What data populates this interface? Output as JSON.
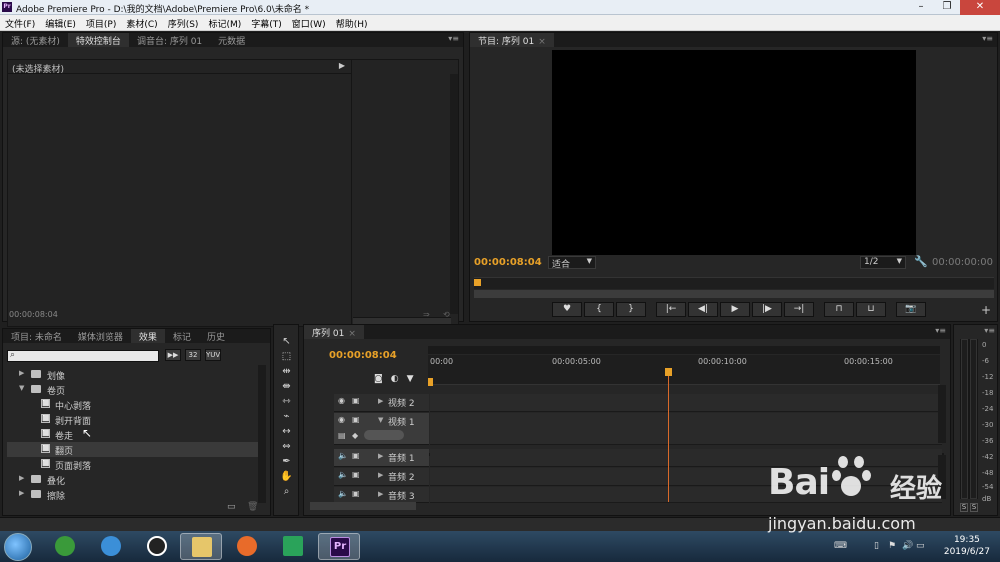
{
  "window": {
    "title": "Adobe Premiere Pro - D:\\我的文档\\Adobe\\Premiere Pro\\6.0\\未命名 *",
    "app_icon_text": "Pr"
  },
  "menu": [
    "文件(F)",
    "编辑(E)",
    "项目(P)",
    "素材(C)",
    "序列(S)",
    "标记(M)",
    "字幕(T)",
    "窗口(W)",
    "帮助(H)"
  ],
  "source_panel": {
    "tabs": [
      {
        "label": "源: (无素材)"
      },
      {
        "label": "特效控制台",
        "active": true
      },
      {
        "label": "调音台: 序列 01"
      },
      {
        "label": "元数据"
      }
    ],
    "header": "(未选择素材)",
    "timecode": "00:00:08:04"
  },
  "program_monitor": {
    "tab": "节目: 序列 01",
    "timecode": "00:00:08:04",
    "fit": "适合",
    "resolution": "1/2",
    "duration": "00:00:00:00",
    "controls": [
      "♥",
      "{",
      "}",
      "|←",
      "◀|",
      "▶",
      "|▶",
      "→|",
      "⊓",
      "⊔",
      "📷"
    ]
  },
  "project_panel": {
    "tabs": [
      {
        "label": "项目: 未命名"
      },
      {
        "label": "媒体浏览器"
      },
      {
        "label": "效果",
        "active": true
      },
      {
        "label": "标记"
      },
      {
        "label": "历史"
      }
    ],
    "filter_buttons": [
      "32",
      "YUV"
    ],
    "tree": [
      {
        "label": "划像",
        "type": "folder",
        "level": 0,
        "expanded": false
      },
      {
        "label": "卷页",
        "type": "folder",
        "level": 0,
        "expanded": true
      },
      {
        "label": "中心剥落",
        "type": "effect",
        "level": 1
      },
      {
        "label": "剥开背面",
        "type": "effect",
        "level": 1
      },
      {
        "label": "卷走",
        "type": "effect",
        "level": 1
      },
      {
        "label": "翻页",
        "type": "effect",
        "level": 1,
        "selected": true
      },
      {
        "label": "页面剥落",
        "type": "effect",
        "level": 1
      },
      {
        "label": "叠化",
        "type": "folder",
        "level": 0,
        "expanded": false
      },
      {
        "label": "擦除",
        "type": "folder",
        "level": 0,
        "expanded": false
      }
    ]
  },
  "timeline": {
    "tab": "序列 01",
    "timecode": "00:00:08:04",
    "ruler_labels": [
      "00:00",
      "00:00:05:00",
      "00:00:10:00",
      "00:00:15:00"
    ],
    "tracks": [
      {
        "name": "视频 2",
        "kind": "video"
      },
      {
        "name": "视频 1",
        "kind": "video",
        "expanded": true
      },
      {
        "name": "音频 1",
        "kind": "audio"
      },
      {
        "name": "音频 2",
        "kind": "audio"
      },
      {
        "name": "音频 3",
        "kind": "audio"
      }
    ]
  },
  "audio_meter": {
    "db_labels": [
      "0",
      "-6",
      "-12",
      "-18",
      "-24",
      "-30",
      "-36",
      "-42",
      "-48",
      "-54",
      "dB"
    ],
    "solo_buttons": [
      "S",
      "S"
    ]
  },
  "taskbar": {
    "clock_time": "19:35",
    "clock_date": "2019/6/27",
    "apps": [
      "360",
      "ie",
      "qq",
      "explorer",
      "firefox",
      "media",
      "premiere"
    ]
  },
  "watermark": {
    "brand": "Bai",
    "brand_suffix": "经验",
    "url": "jingyan.baidu.com"
  }
}
